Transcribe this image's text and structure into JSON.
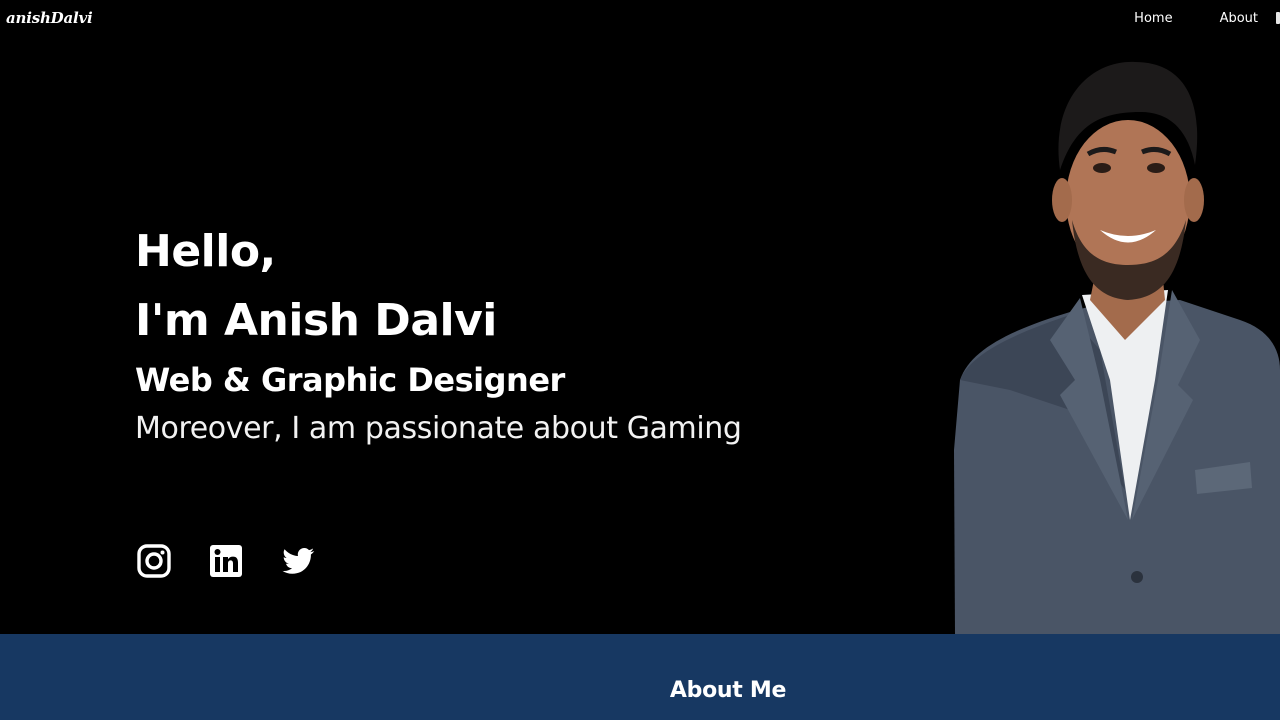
{
  "header": {
    "logo": "anishDalvi",
    "nav": [
      {
        "label": "Home"
      },
      {
        "label": "About"
      }
    ]
  },
  "hero": {
    "greeting": "Hello,",
    "name": "I'm Anish Dalvi",
    "role": "Web & Graphic Designer",
    "tagline": "Moreover, I am passionate about Gaming",
    "socials": [
      {
        "icon": "instagram-icon"
      },
      {
        "icon": "linkedin-icon"
      },
      {
        "icon": "twitter-icon"
      }
    ],
    "portrait_icon": "person-photo"
  },
  "about": {
    "title": "About Me"
  },
  "colors": {
    "background": "#000000",
    "about_section": "#173862",
    "text": "#ffffff"
  }
}
